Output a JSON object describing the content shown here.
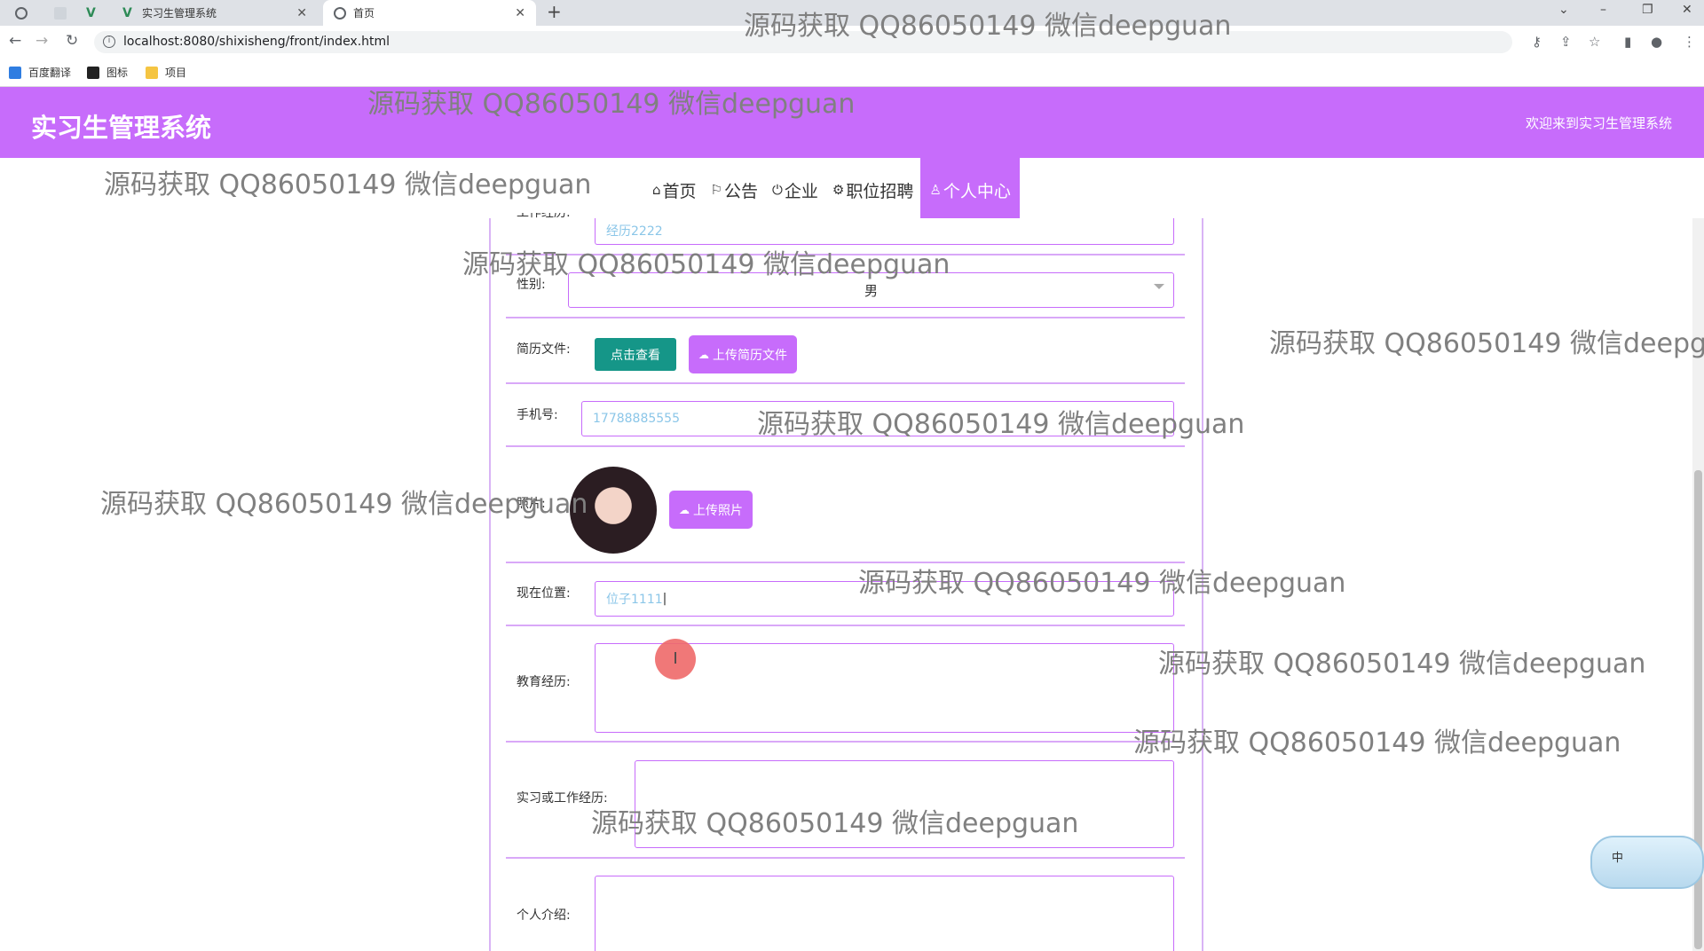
{
  "browser": {
    "tabs": [
      {
        "label": ""
      },
      {
        "label": ""
      },
      {
        "label": ""
      },
      {
        "label": "实习生管理系统"
      },
      {
        "label": "首页"
      }
    ],
    "url": "localhost:8080/shixisheng/front/index.html",
    "bookmarks": [
      {
        "label": "百度翻译"
      },
      {
        "label": "图标"
      },
      {
        "label": "项目"
      }
    ]
  },
  "header": {
    "title": "实习生管理系统",
    "welcome": "欢迎来到实习生管理系统"
  },
  "nav": [
    {
      "label": "首页",
      "icon": "home-icon",
      "glyph": "⌂"
    },
    {
      "label": "公告",
      "icon": "flag-icon",
      "glyph": "⚐"
    },
    {
      "label": "企业",
      "icon": "power-icon",
      "glyph": "⏻"
    },
    {
      "label": "职位招聘",
      "icon": "gear-icon",
      "glyph": "⚙"
    },
    {
      "label": "个人中心",
      "icon": "user-icon",
      "glyph": "♙"
    }
  ],
  "form": {
    "work_exp_label": "工作经历:",
    "work_exp_value": "经历2222",
    "gender_label": "性别:",
    "gender_value": "男",
    "resume_label": "简历文件:",
    "view_button": "点击查看",
    "upload_resume_button": "上传简历文件",
    "phone_label": "手机号:",
    "phone_value": "17788885555",
    "photo_label": "照片:",
    "upload_photo_button": "上传照片",
    "location_label": "现在位置:",
    "location_value": "位子1111",
    "education_label": "教育经历:",
    "internship_label": "实习或工作经历:",
    "intro_label": "个人介绍:"
  },
  "ime": {
    "label": "中"
  },
  "watermark": "源码获取 QQ86050149 微信deepguan",
  "colors": {
    "accent": "#c76cfb",
    "teal": "#159688"
  }
}
